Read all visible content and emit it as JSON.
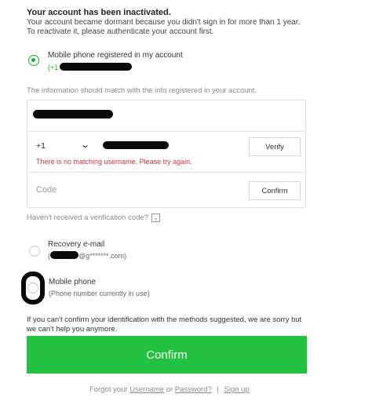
{
  "header": {
    "title": "Your account has been inactivated.",
    "line1": "Your account became dormant because you didn't sign in for more than 1 year.",
    "line2": "To reactivate it, please authenticate your account first."
  },
  "options": {
    "mobile_registered": {
      "label": "Mobile phone registered in my account",
      "sub_prefix": "(+1"
    },
    "recovery_email": {
      "label": "Recovery e-mail",
      "sub_prefix": "(",
      "sub_suffix": "@g*******.com)"
    },
    "mobile_phone": {
      "label": "Mobile phone",
      "sub": "(Phone number currently in use)"
    }
  },
  "form": {
    "note": "The information should match with the info registered in your account.",
    "country_code": "+1",
    "verify_label": "Verify",
    "error": "There is no matching username. Please try again.",
    "code_placeholder": "Code",
    "confirm_small_label": "Confirm"
  },
  "resend": {
    "text": "Haven't received a verification code?"
  },
  "footer": {
    "text": "If you can't confirm your identification with the methods suggested, we are sorry but we can't help you anymore.",
    "confirm_label": "Confirm",
    "links": {
      "prefix": "Forgot your",
      "username": "Username",
      "or": "or",
      "password": "Password?",
      "sep": "|",
      "signup": "Sign up"
    }
  },
  "colors": {
    "accent": "#22c240",
    "radio_checked": "#19b12f",
    "error": "#d0343b"
  }
}
